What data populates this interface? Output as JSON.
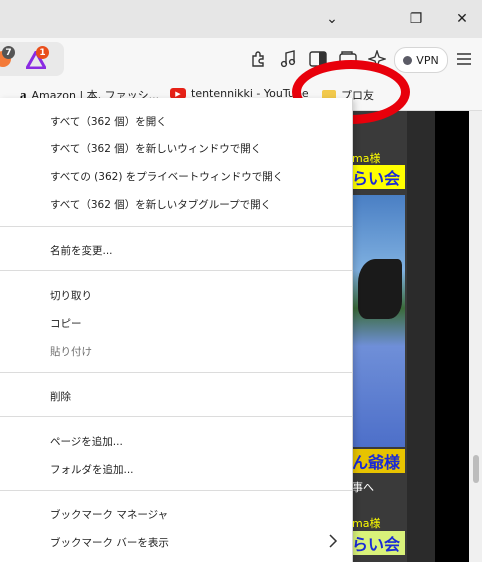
{
  "titlebar": {
    "minimize": "⌄",
    "restore": "❐",
    "close": "✕"
  },
  "toolbar": {
    "badge_left": "7",
    "badge_right": "1",
    "vpn_label": "VPN",
    "icons": [
      "extensions-icon",
      "music-icon",
      "sidebar-icon",
      "container-icon",
      "leo-icon",
      "menu-icon"
    ]
  },
  "bookmarks_bar": {
    "amazon_label": "Amazon | 本, ファッシ...",
    "youtube_label": "tentennikki - YouTube",
    "folder_label": "プロ友"
  },
  "web": {
    "text_top": "ma様",
    "banner1": "らい会",
    "banner2": "ん爺様",
    "text_mid": "事へ",
    "text_low": "ma様",
    "banner3": "らい会",
    "accent_yellow": "#ffff00",
    "accent_blue": "#1a2ad6"
  },
  "menu": {
    "open_all": "すべて（362 個）を開く",
    "open_all_new_window": "すべて（362 個）を新しいウィンドウで開く",
    "open_all_private": "すべての (362) をプライベートウィンドウで開く",
    "open_all_tab_group": "すべて（362 個）を新しいタブグループで開く",
    "rename": "名前を変更...",
    "cut": "切り取り",
    "copy": "コピー",
    "paste": "貼り付け",
    "delete": "削除",
    "add_page": "ページを追加...",
    "add_folder": "フォルダを追加...",
    "bookmark_manager": "ブックマーク マネージャ",
    "show_bookmarks_bar": "ブックマーク バーを表示"
  }
}
